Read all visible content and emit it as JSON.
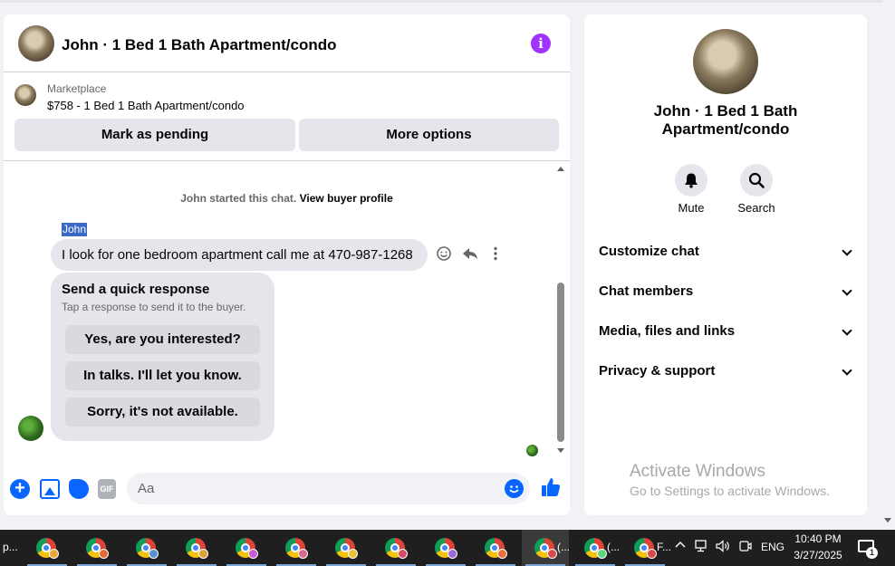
{
  "chat": {
    "title": "John · 1 Bed 1 Bath Apartment/condo",
    "info_icon": "info-icon",
    "marketplace": {
      "label": "Marketplace",
      "listing": "$758 - 1 Bed 1 Bath Apartment/condo"
    },
    "buttons": {
      "mark_pending": "Mark as pending",
      "more_options": "More options"
    },
    "started_text": "John started this chat.",
    "view_profile": "View buyer profile",
    "sender_name": "John",
    "message": "I look for one bedroom apartment call me at 470-987-1268",
    "message_actions": [
      "react-icon",
      "reply-icon",
      "more-icon"
    ],
    "quick_response": {
      "title": "Send a quick response",
      "subtitle": "Tap a response to send it to the buyer.",
      "options": [
        "Yes, are you interested?",
        "In talks. I'll let you know.",
        "Sorry, it's not available."
      ]
    },
    "composer": {
      "placeholder": "Aa",
      "gif_label": "GIF",
      "icons": [
        "plus-icon",
        "photo-icon",
        "sticker-icon",
        "gif-icon",
        "emoji-icon",
        "like-icon"
      ]
    }
  },
  "info_panel": {
    "name": "John · 1 Bed 1 Bath Apartment/condo",
    "actions": [
      {
        "label": "Mute",
        "icon": "bell-icon"
      },
      {
        "label": "Search",
        "icon": "search-icon"
      }
    ],
    "sections": [
      "Customize chat",
      "Chat members",
      "Media, files and links",
      "Privacy & support"
    ]
  },
  "watermark": {
    "title": "Activate Windows",
    "subtitle": "Go to Settings to activate Windows."
  },
  "taskbar": {
    "first_label": "p...",
    "apps": [
      {
        "profile_color": "#e8a838"
      },
      {
        "profile_color": "#e86a3a"
      },
      {
        "profile_color": "#5b8fd6"
      },
      {
        "profile_color": "#d9a33a"
      },
      {
        "profile_color": "#c75bd6"
      },
      {
        "profile_color": "#d66a8f"
      },
      {
        "profile_color": "#e8c238"
      },
      {
        "profile_color": "#d64a6a"
      },
      {
        "profile_color": "#9a6ad6"
      },
      {
        "profile_color": "#e8703a"
      },
      {
        "profile_color": "#d64a4a",
        "label": "(...",
        "active": true
      },
      {
        "profile_color": "#5bd67a",
        "label": "(..."
      },
      {
        "profile_color": "#d64a4a",
        "label": "F..."
      }
    ],
    "tray": {
      "language": "ENG",
      "time": "10:40 PM",
      "date": "3/27/2025",
      "notifications": "1"
    }
  },
  "colors": {
    "accent": "#0866ff",
    "info": "#a033ff",
    "bubble": "#e4e6eb",
    "background": "#f0f2f5"
  }
}
